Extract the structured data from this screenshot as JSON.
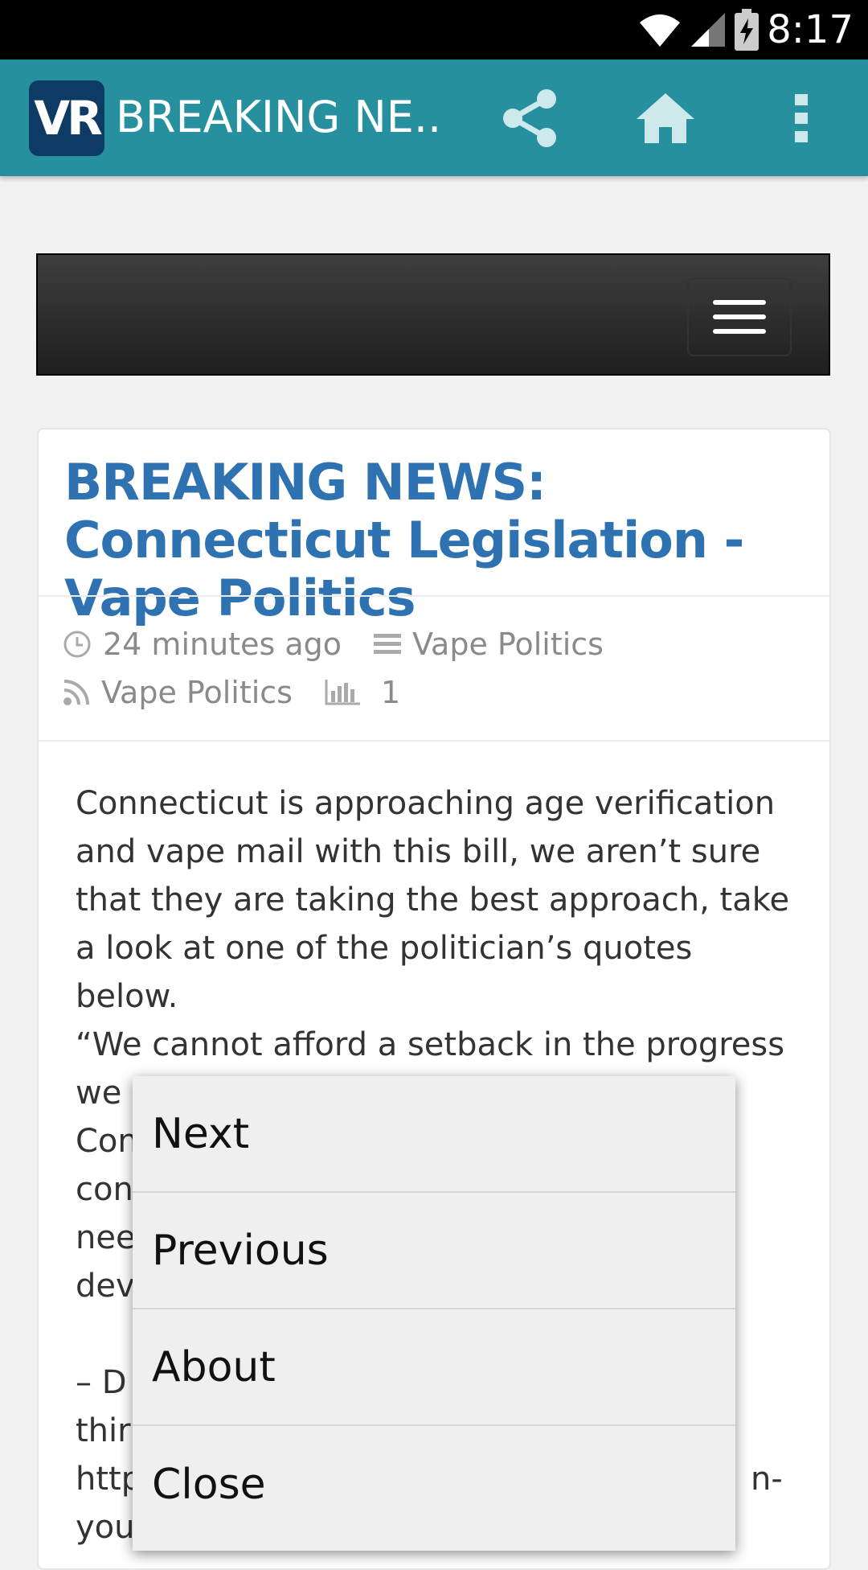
{
  "status_bar": {
    "time": "8:17"
  },
  "action_bar": {
    "logo_text": "VR",
    "title": "BREAKING NE...",
    "accent": "#26909f"
  },
  "article": {
    "title": "BREAKING NEWS: Connecticut Legislation - Vape Politics",
    "meta": {
      "time_ago": "24 minutes ago",
      "category": "Vape Politics",
      "feed": "Vape Politics",
      "views": "1"
    },
    "paragraphs": [
      "Connecticut is approaching age verification and vape mail with this bill, we aren’t sure that they are taking the best approach, take a look at one of the politician’s quotes below.",
      "“We cannot afford a setback in the progress we have made limiting tobacco use. Consumers nee",
      "con",
      "nee",
      "devi"
    ],
    "fragments": {
      "attribution": "– D",
      "line2": "thir",
      "link_start": "http",
      "link_end": "n-",
      "line4": "you"
    }
  },
  "menu": {
    "items": [
      "Next",
      "Previous",
      "About",
      "Close"
    ]
  }
}
